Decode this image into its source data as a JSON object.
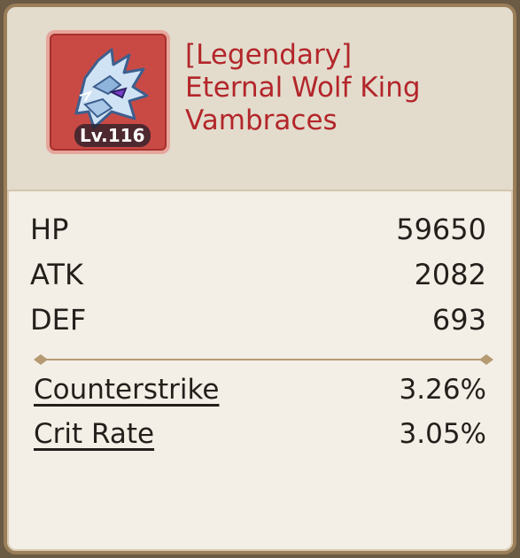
{
  "item": {
    "rarity_label": "[Legendary]",
    "name_line1": "Eternal Wolf King",
    "name_line2": "Vambraces",
    "level_badge": "Lv.116",
    "icon": "wolf-helm-icon",
    "frame_color": "#c94a44",
    "title_color": "#b3262a"
  },
  "stats": [
    {
      "name": "HP",
      "value": "59650"
    },
    {
      "name": "ATK",
      "value": "2082"
    },
    {
      "name": "DEF",
      "value": "693"
    }
  ],
  "sub_stats": [
    {
      "name": "Counterstrike",
      "value": "3.26%"
    },
    {
      "name": "Crit Rate",
      "value": "3.05%"
    }
  ]
}
